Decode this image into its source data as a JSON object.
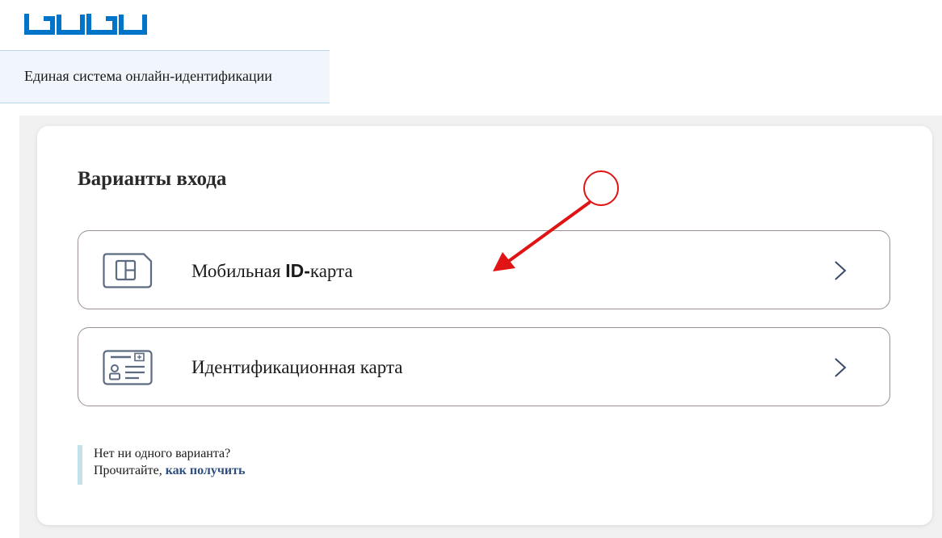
{
  "header": {
    "logo_icon": "tutu-logo",
    "banner_text": "Единая система онлайн-идентификации"
  },
  "login": {
    "title": "Варианты входа",
    "options": [
      {
        "label_prefix": "Мобильная ",
        "label_bold": "ID-",
        "label_suffix": "карта",
        "icon": "sim-card-icon"
      },
      {
        "label": "Идентификационная карта",
        "icon": "id-card-icon"
      }
    ],
    "help": {
      "line1": "Нет ни одного варианта?",
      "line2_prefix": "Прочитайте, ",
      "link": "как получить"
    }
  },
  "colors": {
    "accent_blue": "#0074c8",
    "icon_slate": "#5c6b80",
    "card_border": "#9a8e99",
    "link_color": "#2e4e7e",
    "banner_bg": "#f0f6fb",
    "help_bar": "#c5e2ec",
    "annotation_red": "#e01414"
  }
}
